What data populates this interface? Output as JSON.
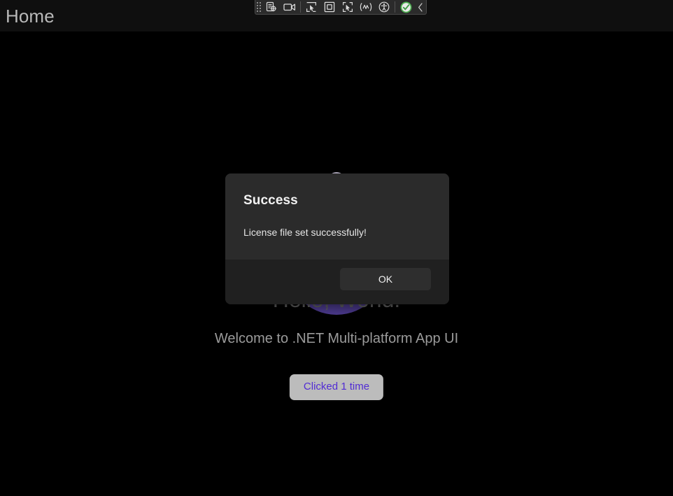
{
  "window": {
    "background_color": "#000000"
  },
  "header": {
    "title": "Home",
    "background_color": "#0f0f0f",
    "title_color": "#b9b9b9"
  },
  "main": {
    "hero_image": "dotnet-bot-illustration",
    "hello_text": "Hello, World!",
    "welcome_text": "Welcome to .NET Multi-platform App UI",
    "counter_button_label": "Clicked 1 time",
    "counter_button_bg": "#bcbcbc",
    "counter_button_text_color": "#512bd4",
    "brand_purple": "#512bd4"
  },
  "dialog": {
    "title": "Success",
    "message": "License file set successfully!",
    "ok_label": "OK",
    "body_bg": "#2b2b2b",
    "footer_bg": "#202020",
    "button_bg": "#2e2e2e"
  },
  "automation_toolbar": {
    "drag_handle": "grip-dots-icon",
    "items": [
      {
        "name": "inspect-element-icon",
        "label": "Inspect element"
      },
      {
        "name": "record-video-icon",
        "label": "Record"
      },
      {
        "name": "cursor-select-icon",
        "label": "Select"
      },
      {
        "name": "square-highlight-icon",
        "label": "Highlight region"
      },
      {
        "name": "cursor-region-select-icon",
        "label": "Select region"
      },
      {
        "name": "waveform-icon",
        "label": "Animations"
      },
      {
        "name": "accessibility-icon",
        "label": "Accessibility"
      },
      {
        "name": "check-circle-icon",
        "label": "Status OK"
      }
    ],
    "collapse": "chevron-left-icon",
    "background_color": "#2b2b2b",
    "border_color": "#4a4a4a",
    "check_color": "#4caf50"
  }
}
